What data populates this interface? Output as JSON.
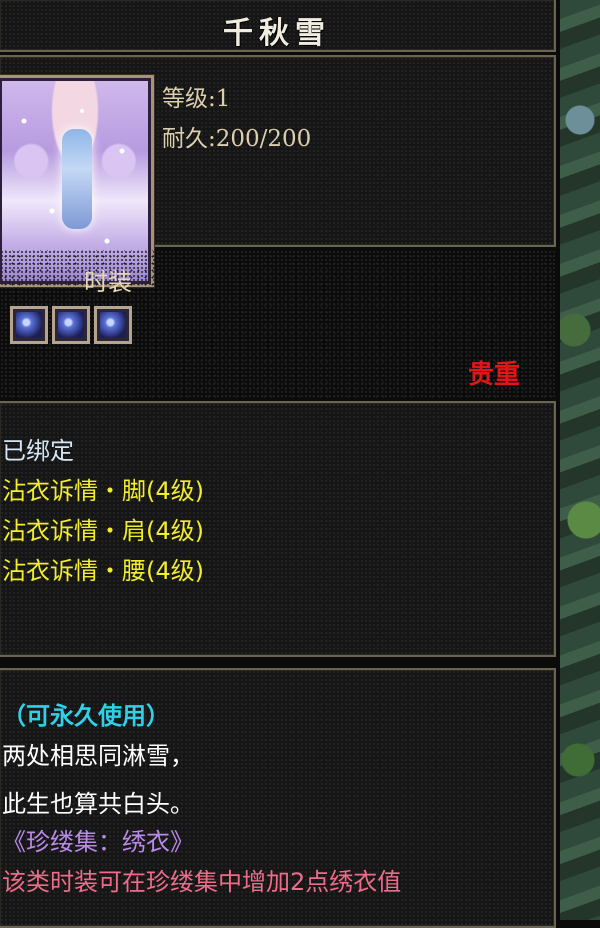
{
  "item": {
    "name": "千秋雪",
    "level_label": "等级:1",
    "durability_label": "耐久:200/200",
    "category": "时装",
    "gem_slots": [
      "purple-gem-icon",
      "purple-gem-icon",
      "purple-gem-icon"
    ],
    "rarity": "贵重"
  },
  "effects": {
    "bound": "已绑定",
    "list": [
      "沾衣诉情・脚(4级)",
      "沾衣诉情・肩(4级)",
      "沾衣诉情・腰(4级)"
    ]
  },
  "description": {
    "permanent": "（可永久使用）",
    "poem_line1": "两处相思同淋雪，",
    "poem_line2": "此生也算共白头。",
    "collection": "《珍缕集：绣衣》",
    "note": "该类时装可在珍缕集中增加2点绣衣值"
  },
  "colors": {
    "title": "#f0ece0",
    "stats": "#dccfae",
    "rarity": "#e21616",
    "effects": "#f2ee2c",
    "permanent": "#2fd0e8",
    "collection": "#b98ae8",
    "note": "#ee6b8a"
  }
}
